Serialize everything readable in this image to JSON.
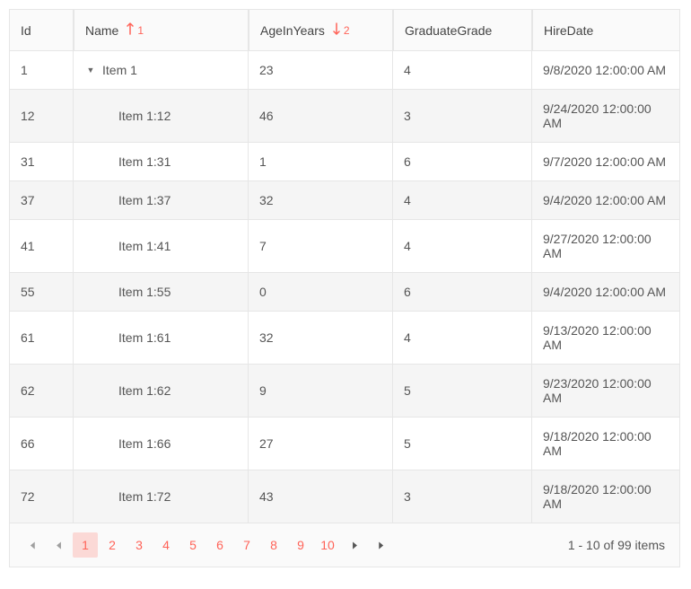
{
  "columns": [
    {
      "key": "id",
      "label": "Id"
    },
    {
      "key": "name",
      "label": "Name",
      "sortDir": "asc",
      "sortOrder": "1"
    },
    {
      "key": "age",
      "label": "AgeInYears",
      "sortDir": "desc",
      "sortOrder": "2"
    },
    {
      "key": "grade",
      "label": "GraduateGrade"
    },
    {
      "key": "hire",
      "label": "HireDate"
    }
  ],
  "rows": [
    {
      "id": "1",
      "name": "Item 1",
      "age": "23",
      "grade": "4",
      "hire": "9/8/2020 12:00:00 AM",
      "level": 0,
      "expanded": true
    },
    {
      "id": "12",
      "name": "Item 1:12",
      "age": "46",
      "grade": "3",
      "hire": "9/24/2020 12:00:00 AM",
      "level": 1
    },
    {
      "id": "31",
      "name": "Item 1:31",
      "age": "1",
      "grade": "6",
      "hire": "9/7/2020 12:00:00 AM",
      "level": 1
    },
    {
      "id": "37",
      "name": "Item 1:37",
      "age": "32",
      "grade": "4",
      "hire": "9/4/2020 12:00:00 AM",
      "level": 1
    },
    {
      "id": "41",
      "name": "Item 1:41",
      "age": "7",
      "grade": "4",
      "hire": "9/27/2020 12:00:00 AM",
      "level": 1
    },
    {
      "id": "55",
      "name": "Item 1:55",
      "age": "0",
      "grade": "6",
      "hire": "9/4/2020 12:00:00 AM",
      "level": 1
    },
    {
      "id": "61",
      "name": "Item 1:61",
      "age": "32",
      "grade": "4",
      "hire": "9/13/2020 12:00:00 AM",
      "level": 1
    },
    {
      "id": "62",
      "name": "Item 1:62",
      "age": "9",
      "grade": "5",
      "hire": "9/23/2020 12:00:00 AM",
      "level": 1
    },
    {
      "id": "66",
      "name": "Item 1:66",
      "age": "27",
      "grade": "5",
      "hire": "9/18/2020 12:00:00 AM",
      "level": 1
    },
    {
      "id": "72",
      "name": "Item 1:72",
      "age": "43",
      "grade": "3",
      "hire": "9/18/2020 12:00:00 AM",
      "level": 1
    }
  ],
  "pager": {
    "pages": [
      "1",
      "2",
      "3",
      "4",
      "5",
      "6",
      "7",
      "8",
      "9",
      "10"
    ],
    "current": "1",
    "status": "1 - 10 of 99 items"
  }
}
